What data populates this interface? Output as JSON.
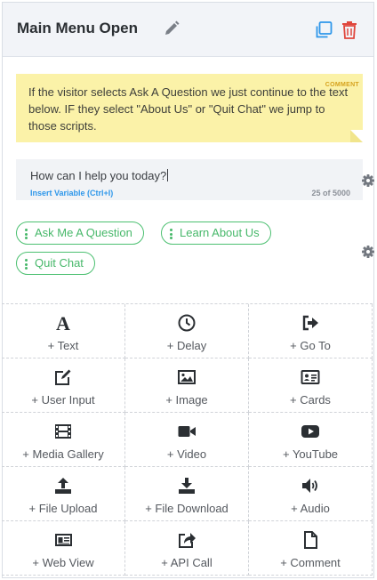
{
  "header": {
    "title": "Main Menu Open"
  },
  "comment": {
    "tag": "COMMENT",
    "text": "If the visitor selects Ask A Question we just continue to the text below. IF they select \"About Us\" or \"Quit Chat\" we jump to those scripts."
  },
  "message": {
    "text": "How can I help you today?",
    "insert_variable": "Insert Variable (Ctrl+I)",
    "counter": "25 of 5000"
  },
  "quick_replies": [
    "Ask Me A Question",
    "Learn About Us",
    "Quit Chat"
  ],
  "actions": [
    {
      "label": "+ Text",
      "icon": "text-icon"
    },
    {
      "label": "+ Delay",
      "icon": "clock-icon"
    },
    {
      "label": "+ Go To",
      "icon": "sign-out-icon"
    },
    {
      "label": "+ User Input",
      "icon": "edit-icon"
    },
    {
      "label": "+ Image",
      "icon": "image-icon"
    },
    {
      "label": "+ Cards",
      "icon": "id-card-icon"
    },
    {
      "label": "+ Media Gallery",
      "icon": "film-icon"
    },
    {
      "label": "+ Video",
      "icon": "video-camera-icon"
    },
    {
      "label": "+ YouTube",
      "icon": "youtube-icon"
    },
    {
      "label": "+ File Upload",
      "icon": "upload-icon"
    },
    {
      "label": "+ File Download",
      "icon": "download-icon"
    },
    {
      "label": "+ Audio",
      "icon": "volume-icon"
    },
    {
      "label": "+ Web View",
      "icon": "newspaper-icon"
    },
    {
      "label": "+ API Call",
      "icon": "share-icon"
    },
    {
      "label": "+ Comment",
      "icon": "file-icon"
    }
  ],
  "colors": {
    "accent_blue": "#2e97ea",
    "delete_red": "#e0473d",
    "quick_reply_green": "#47b86a",
    "comment_yellow": "#fbf2a8"
  }
}
